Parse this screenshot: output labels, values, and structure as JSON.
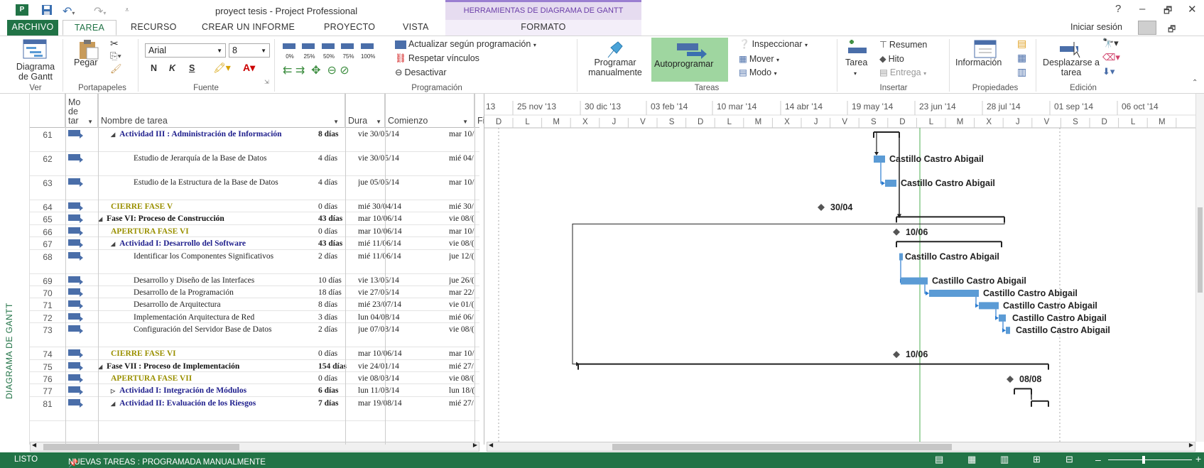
{
  "window": {
    "title": "proyect tesis - Project Professional",
    "context_tab_group": "HERRAMIENTAS DE DIAGRAMA DE GANTT",
    "help": "?",
    "minimize": "–",
    "restore": "🗗",
    "close": "✕"
  },
  "menu": {
    "file": "ARCHIVO",
    "tabs": [
      "TAREA",
      "RECURSO",
      "CREAR UN INFORME",
      "PROYECTO",
      "VISTA"
    ],
    "format": "FORMATO",
    "signin": "Iniciar sesión"
  },
  "ribbon": {
    "view": {
      "button": "Diagrama de Gantt",
      "group": "Ver"
    },
    "clipboard": {
      "paste": "Pegar",
      "group": "Portapapeles"
    },
    "font": {
      "family": "Arial",
      "size": "8",
      "bold": "N",
      "italic": "K",
      "underline": "S",
      "group": "Fuente"
    },
    "schedule": {
      "pct": [
        "0%",
        "25%",
        "50%",
        "75%",
        "100%"
      ],
      "update": "Actualizar según programación",
      "respect": "Respetar vínculos",
      "deactivate": "Desactivar",
      "group": "Programación"
    },
    "tasks": {
      "manual": "Programar manualmente",
      "auto": "Autoprogramar",
      "inspect": "Inspeccionar",
      "move": "Mover",
      "mode": "Modo",
      "group": "Tareas"
    },
    "insert": {
      "task": "Tarea",
      "summary": "Resumen",
      "milestone": "Hito",
      "deliverable": "Entrega",
      "group": "Insertar"
    },
    "properties": {
      "info": "Información",
      "group": "Propiedades"
    },
    "editing": {
      "scroll": "Desplazarse a tarea",
      "group": "Edición"
    }
  },
  "side_label": "DIAGRAMA DE GANTT",
  "columns": {
    "mode": "Mo de tar",
    "name": "Nombre de tarea",
    "duration": "Dura",
    "start": "Comienzo",
    "end": "Fin"
  },
  "rows": [
    {
      "id": "61",
      "level": "summary",
      "indent": 2,
      "name": "Actividad III : Administración de Información",
      "duration": "8 días",
      "start": "vie 30/05/14",
      "end": "mar 10/",
      "tall": true
    },
    {
      "id": "62",
      "level": "task",
      "indent": 3,
      "name": "Estudio de Jerarquía de la Base de Datos",
      "duration": "4 días",
      "start": "vie 30/05/14",
      "end": "mié 04/",
      "tall": true
    },
    {
      "id": "63",
      "level": "task",
      "indent": 3,
      "name": "Estudio de la Estructura de la Base de Datos",
      "duration": "4 días",
      "start": "jue 05/06/14",
      "end": "mar 10/",
      "tall": true
    },
    {
      "id": "64",
      "level": "milestone",
      "indent": 2,
      "name": "CIERRE FASE V",
      "duration": "0 días",
      "start": "mié 30/04/14",
      "end": "mié 30/",
      "tall": false
    },
    {
      "id": "65",
      "level": "phase",
      "indent": 1,
      "name": "Fase VI: Proceso de Construcción",
      "duration": "43 días",
      "start": "mar 10/06/14",
      "end": "vie 08/(",
      "tall": false
    },
    {
      "id": "66",
      "level": "milestone",
      "indent": 2,
      "name": "APERTURA FASE VI",
      "duration": "0 días",
      "start": "mar 10/06/14",
      "end": "mar 10/",
      "tall": false
    },
    {
      "id": "67",
      "level": "summary",
      "indent": 2,
      "name": "Actividad I: Desarrollo del Software",
      "duration": "43 días",
      "start": "mié 11/06/14",
      "end": "vie 08/(",
      "tall": false
    },
    {
      "id": "68",
      "level": "task",
      "indent": 3,
      "name": "Identificar los Componentes Significativos",
      "duration": "2 días",
      "start": "mié 11/06/14",
      "end": "jue 12/(",
      "tall": true
    },
    {
      "id": "69",
      "level": "task",
      "indent": 3,
      "name": "Desarrollo y Diseño de las Interfaces",
      "duration": "10 días",
      "start": "vie 13/06/14",
      "end": "jue 26/(",
      "tall": false
    },
    {
      "id": "70",
      "level": "task",
      "indent": 3,
      "name": "Desarrollo de la Programación",
      "duration": "18 días",
      "start": "vie 27/06/14",
      "end": "mar 22/",
      "tall": false
    },
    {
      "id": "71",
      "level": "task",
      "indent": 3,
      "name": "Desarrollo de Arquitectura",
      "duration": "8 días",
      "start": "mié 23/07/14",
      "end": "vie 01/(",
      "tall": false
    },
    {
      "id": "72",
      "level": "task",
      "indent": 3,
      "name": "Implementación Arquitectura de Red",
      "duration": "3 días",
      "start": "lun 04/08/14",
      "end": "mié 06/",
      "tall": false
    },
    {
      "id": "73",
      "level": "task",
      "indent": 3,
      "name": "Configuración del Servidor Base de Datos",
      "duration": "2 días",
      "start": "jue 07/08/14",
      "end": "vie 08/(",
      "tall": true
    },
    {
      "id": "74",
      "level": "milestone",
      "indent": 2,
      "name": "CIERRE FASE VI",
      "duration": "0 días",
      "start": "mar 10/06/14",
      "end": "mar 10/",
      "tall": false
    },
    {
      "id": "75",
      "level": "phase",
      "indent": 1,
      "name": "Fase VII : Proceso de Implementación",
      "duration": "154 días",
      "start": "vie 24/01/14",
      "end": "mié 27/",
      "tall": false
    },
    {
      "id": "76",
      "level": "milestone",
      "indent": 2,
      "name": "APERTURA FASE VII",
      "duration": "0 días",
      "start": "vie 08/08/14",
      "end": "vie 08/(",
      "tall": false
    },
    {
      "id": "77",
      "level": "summary",
      "indent": 2,
      "name": "Actividad I: Integración de Módulos",
      "duration": "6 días",
      "start": "lun 11/08/14",
      "end": "lun 18/(",
      "tall": false,
      "collapsed": true
    },
    {
      "id": "81",
      "level": "summary",
      "indent": 2,
      "name": "Actividad II: Evaluación de los Riesgos",
      "duration": "7 días",
      "start": "mar 19/08/14",
      "end": "mié 27/",
      "tall": true
    }
  ],
  "timescale": {
    "top": [
      "13",
      "25 nov '13",
      "30 dic '13",
      "03 feb '14",
      "10 mar '14",
      "14 abr '14",
      "19 may '14",
      "23 jun '14",
      "28 jul '14",
      "01 sep '14",
      "06 oct '14"
    ],
    "days": [
      "D",
      "L",
      "M",
      "X",
      "J",
      "V",
      "S",
      "D",
      "L",
      "M",
      "X",
      "J",
      "V",
      "S",
      "D",
      "L",
      "M",
      "X",
      "J",
      "V",
      "S",
      "D",
      "L",
      "M"
    ]
  },
  "gantt_labels": {
    "resource": "Castillo Castro Abigail",
    "m64": "30/04",
    "m66": "10/06",
    "m74": "10/06",
    "m76": "08/08"
  },
  "status": {
    "ready": "LISTO",
    "new_tasks": "NUEVAS TAREAS : PROGRAMADA MANUALMENTE"
  },
  "colors": {
    "office_green": "#217346",
    "bar_blue": "#5b9bd5",
    "summary_black": "#222222",
    "today_line": "#4caf50"
  }
}
